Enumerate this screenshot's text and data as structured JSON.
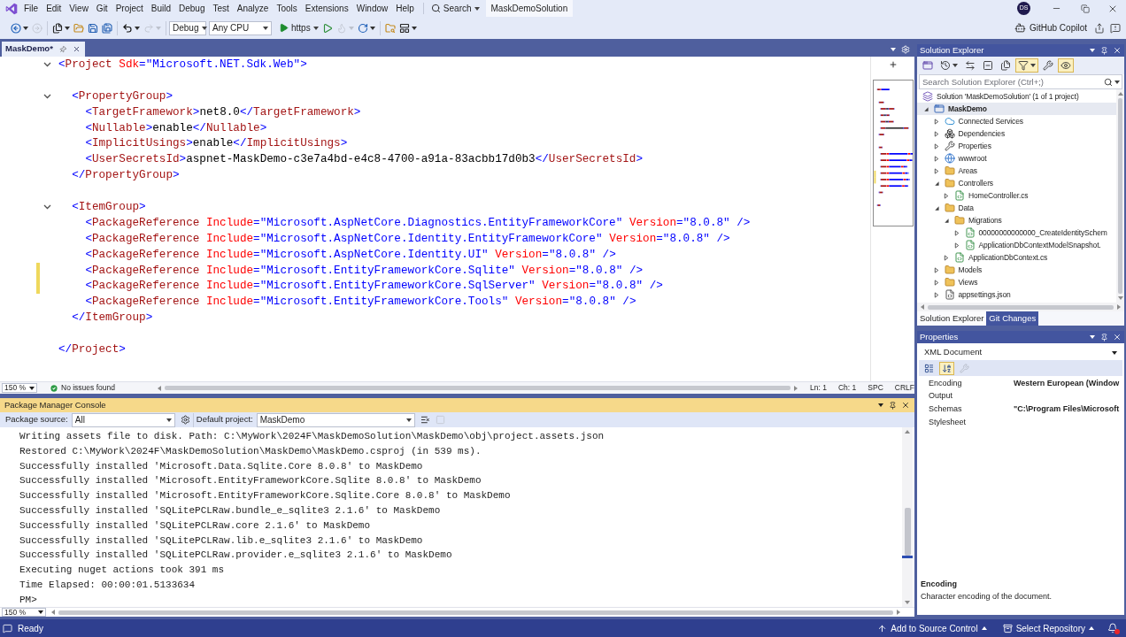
{
  "title_bar": {
    "menu": [
      "File",
      "Edit",
      "View",
      "Git",
      "Project",
      "Build",
      "Debug",
      "Test",
      "Analyze",
      "Tools",
      "Extensions",
      "Window",
      "Help"
    ],
    "search": "Search",
    "solution_name": "MaskDemoSolution",
    "account": "DS"
  },
  "toolbar": {
    "navigation": [
      {
        "kind": "back",
        "disabled": false
      },
      {
        "kind": "forward",
        "disabled": true
      }
    ],
    "file": [
      {
        "kind": "new-project",
        "disabled": false
      },
      {
        "kind": "open",
        "disabled": false
      },
      {
        "kind": "save",
        "disabled": false
      },
      {
        "kind": "save-all",
        "disabled": false
      }
    ],
    "edit": [
      {
        "kind": "undo",
        "disabled": false
      },
      {
        "kind": "redo",
        "disabled": true
      }
    ],
    "configuration": "Debug",
    "platform": "Any CPU",
    "run_target": "https",
    "debug": [
      {
        "kind": "start-without-debugging",
        "disabled": false
      },
      {
        "kind": "hot-reload",
        "disabled": true
      },
      {
        "kind": "restart",
        "disabled": false
      }
    ],
    "windows": [
      {
        "kind": "find-in-folder",
        "disabled": false
      },
      {
        "kind": "layout",
        "disabled": false
      }
    ],
    "copilot": "GitHub Copilot"
  },
  "document_tabs": [
    {
      "label": "MaskDemo*",
      "selected": true
    }
  ],
  "editor": {
    "lines": [
      {
        "kind": "code",
        "text": "<Project Sdk=\"Microsoft.NET.Sdk.Web\">",
        "changed": false,
        "expanded": true,
        "children": [
          {
            "kind": "blank"
          },
          {
            "kind": "code",
            "text": "<PropertyGroup>",
            "changed": false,
            "expanded": true,
            "children": [
              {
                "kind": "code",
                "text": "<TargetFramework>net8.0</TargetFramework>",
                "changed": false
              },
              {
                "kind": "code",
                "text": "<Nullable>enable</Nullable>",
                "changed": false
              },
              {
                "kind": "code",
                "text": "<ImplicitUsings>enable</ImplicitUsings>",
                "changed": false
              },
              {
                "kind": "code",
                "text": "<UserSecretsId>aspnet-MaskDemo-c3e7a4bd-e4c8-4700-a91a-83acbb17d0b3</UserSecretsId>",
                "changed": false
              }
            ]
          },
          {
            "kind": "code",
            "text": "</PropertyGroup>",
            "changed": false
          },
          {
            "kind": "blank"
          },
          {
            "kind": "code",
            "text": "<ItemGroup>",
            "changed": false,
            "expanded": true,
            "children": [
              {
                "kind": "code",
                "text": "<PackageReference Include=\"Microsoft.AspNetCore.Diagnostics.EntityFrameworkCore\" Version=\"8.0.8\" />",
                "changed": false
              },
              {
                "kind": "code",
                "text": "<PackageReference Include=\"Microsoft.AspNetCore.Identity.EntityFrameworkCore\" Version=\"8.0.8\" />",
                "changed": false
              },
              {
                "kind": "code",
                "text": "<PackageReference Include=\"Microsoft.AspNetCore.Identity.UI\" Version=\"8.0.8\" />",
                "changed": false
              },
              {
                "kind": "code",
                "text": "<PackageReference Include=\"Microsoft.EntityFrameworkCore.Sqlite\" Version=\"8.0.8\" />",
                "changed": true
              },
              {
                "kind": "code",
                "text": "<PackageReference Include=\"Microsoft.EntityFrameworkCore.SqlServer\" Version=\"8.0.8\" />",
                "changed": true
              },
              {
                "kind": "code",
                "text": "<PackageReference Include=\"Microsoft.EntityFrameworkCore.Tools\" Version=\"8.0.8\" />",
                "changed": false
              }
            ]
          },
          {
            "kind": "code",
            "text": "</ItemGroup>",
            "changed": false
          },
          {
            "kind": "blank"
          }
        ]
      },
      {
        "kind": "code",
        "text": "</Project>",
        "changed": false
      }
    ],
    "status": {
      "zoom": "150 %",
      "issues": "No issues found",
      "line": "Ln: 1",
      "column": "Ch: 1",
      "indentation": "SPC",
      "line_endings": "CRLF"
    }
  },
  "solution_explorer": {
    "title": "Solution Explorer",
    "toolbar": [
      {
        "kind": "switch-views",
        "pressed": false
      },
      {
        "kind": "history",
        "pressed": false
      },
      {
        "kind": "sync",
        "pressed": false
      },
      {
        "kind": "collapse-all",
        "pressed": false
      },
      {
        "kind": "show-all-files",
        "pressed": false
      },
      {
        "kind": "pending-changes-filter",
        "pressed": true
      },
      {
        "kind": "properties",
        "pressed": false
      },
      {
        "kind": "preview",
        "pressed": true
      }
    ],
    "search": {
      "placeholder": "Search Solution Explorer (Ctrl+;)"
    },
    "solution": {
      "label": "Solution 'MaskDemoSolution' (1 of 1 project)",
      "selected": false,
      "children": [
        {
          "label": "MaskDemo",
          "kind": "project",
          "expanded": true,
          "selected": true,
          "children": [
            {
              "label": "Connected Services",
              "kind": "connected-services",
              "expanded": false,
              "selected": false
            },
            {
              "label": "Dependencies",
              "kind": "dependencies",
              "expanded": false,
              "selected": false
            },
            {
              "label": "Properties",
              "kind": "properties",
              "expanded": false,
              "selected": false
            },
            {
              "label": "wwwroot",
              "kind": "web-root",
              "expanded": false,
              "selected": false
            },
            {
              "label": "Areas",
              "kind": "folder",
              "expanded": false,
              "selected": false
            },
            {
              "label": "Controllers",
              "kind": "folder",
              "expanded": true,
              "selected": false,
              "children": [
                {
                  "label": "HomeController.cs",
                  "kind": "csharp",
                  "expanded": false,
                  "selected": false
                }
              ]
            },
            {
              "label": "Data",
              "kind": "folder",
              "expanded": true,
              "selected": false,
              "children": [
                {
                  "label": "Migrations",
                  "kind": "folder",
                  "expanded": true,
                  "selected": false,
                  "children": [
                    {
                      "label": "00000000000000_CreateIdentitySchem",
                      "kind": "csharp",
                      "expanded": false,
                      "selected": false
                    },
                    {
                      "label": "ApplicationDbContextModelSnapshot.",
                      "kind": "csharp",
                      "expanded": false,
                      "selected": false
                    }
                  ]
                },
                {
                  "label": "ApplicationDbContext.cs",
                  "kind": "csharp",
                  "expanded": false,
                  "selected": false
                }
              ]
            },
            {
              "label": "Models",
              "kind": "folder",
              "expanded": false,
              "selected": false
            },
            {
              "label": "Views",
              "kind": "folder",
              "expanded": false,
              "selected": false
            },
            {
              "label": "appsettings.json",
              "kind": "json",
              "expanded": false,
              "selected": false
            }
          ]
        }
      ]
    },
    "tabs": [
      {
        "label": "Solution Explorer",
        "selected": true
      },
      {
        "label": "Git Changes",
        "selected": false
      }
    ]
  },
  "properties": {
    "title": "Properties",
    "object": "XML Document",
    "toolbar": [
      {
        "kind": "categorized",
        "pressed": false,
        "disabled": false
      },
      {
        "kind": "alphabetical",
        "pressed": true,
        "disabled": false
      },
      {
        "kind": "property-pages",
        "pressed": false,
        "disabled": true
      }
    ],
    "rows": [
      {
        "name": "Encoding",
        "value": "Western European (Window"
      },
      {
        "name": "Output"
      },
      {
        "name": "Schemas",
        "value": "\"C:\\Program Files\\Microsoft"
      },
      {
        "name": "Stylesheet"
      }
    ],
    "description": {
      "title": "Encoding",
      "text": "Character encoding of the document."
    }
  },
  "package_manager_console": {
    "title": "Package Manager Console",
    "package_source_label": "Package source:",
    "package_source": "All",
    "default_project_label": "Default project:",
    "default_project": "MaskDemo",
    "actions": [
      {
        "kind": "clear",
        "disabled": false
      },
      {
        "kind": "stop",
        "disabled": true
      }
    ],
    "output": [
      "Writing assets file to disk. Path: C:\\MyWork\\2024F\\MaskDemoSolution\\MaskDemo\\obj\\project.assets.json",
      "Restored C:\\MyWork\\2024F\\MaskDemoSolution\\MaskDemo\\MaskDemo.csproj (in 539 ms).",
      "Successfully installed 'Microsoft.Data.Sqlite.Core 8.0.8' to MaskDemo",
      "Successfully installed 'Microsoft.EntityFrameworkCore.Sqlite 8.0.8' to MaskDemo",
      "Successfully installed 'Microsoft.EntityFrameworkCore.Sqlite.Core 8.0.8' to MaskDemo",
      "Successfully installed 'SQLitePCLRaw.bundle_e_sqlite3 2.1.6' to MaskDemo",
      "Successfully installed 'SQLitePCLRaw.core 2.1.6' to MaskDemo",
      "Successfully installed 'SQLitePCLRaw.lib.e_sqlite3 2.1.6' to MaskDemo",
      "Successfully installed 'SQLitePCLRaw.provider.e_sqlite3 2.1.6' to MaskDemo",
      "Executing nuget actions took 391 ms",
      "Time Elapsed: 00:00:01.5133634",
      "PM>"
    ],
    "zoom": "150 %"
  },
  "status_bar": {
    "message": "Ready",
    "source_control": "Add to Source Control",
    "repository": "Select Repository"
  }
}
